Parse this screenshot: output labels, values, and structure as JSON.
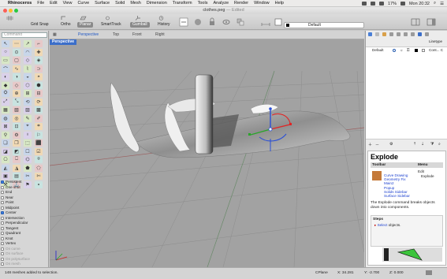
{
  "menubar": {
    "app_name": "Rhinoceros",
    "items": [
      "File",
      "Edit",
      "View",
      "Curve",
      "Surface",
      "Solid",
      "Mesh",
      "Dimension",
      "Transform",
      "Tools",
      "Analyze",
      "Render",
      "Window",
      "Help"
    ],
    "battery": "17%",
    "clock": "Mon 20:32"
  },
  "window": {
    "title": "clothes.peg",
    "edited_label": "— Edited"
  },
  "toolbar": {
    "buttons": [
      "Grid Snap",
      "Ortho",
      "Planar",
      "SmartTrack",
      "Gumball",
      "History"
    ],
    "active_buttons": [
      "Planar",
      "Gumball"
    ],
    "layer_value": "Default"
  },
  "command": {
    "placeholder": "Command"
  },
  "tools": [
    "↖",
    "⋯",
    "↗",
    "⌐",
    "○",
    "⊙",
    "◠",
    "✚",
    "▭",
    "▢",
    "◇",
    "◈",
    "⌒",
    "∿",
    "⌇",
    "⊃",
    "◐",
    "◑",
    "◒",
    "◓",
    "◆",
    "◇",
    "⬡",
    "⬢",
    "⛭",
    "⊕",
    "⊞",
    "⊟",
    "⤢",
    "⤡",
    "⟲",
    "⟳",
    "▦",
    "▧",
    "▨",
    "▩",
    "◍",
    "◎",
    "✎",
    "✐",
    "⊠",
    "⊡",
    "⌖",
    "⌗",
    "⚲",
    "⚙",
    "♁",
    "⚐",
    "❏",
    "❐",
    "⬚",
    "⬛",
    "◪",
    "◩",
    "☐",
    "☑",
    "⎔",
    "⎕",
    "⌬",
    "⍟",
    "◭",
    "◮",
    "⬟",
    "⬠",
    "▣",
    "▤",
    "✂",
    "✄",
    "⚒",
    "⚓",
    "⚑",
    "⚬"
  ],
  "osnap": [
    {
      "label": "Persistent",
      "on": true,
      "dim": false
    },
    {
      "label": "One shot",
      "on": false,
      "dim": false
    },
    {
      "label": "End",
      "on": false,
      "dim": false
    },
    {
      "label": "Near",
      "on": false,
      "dim": false
    },
    {
      "label": "Point",
      "on": false,
      "dim": false
    },
    {
      "label": "Midpoint",
      "on": false,
      "dim": false
    },
    {
      "label": "Center",
      "on": true,
      "dim": false
    },
    {
      "label": "Intersection",
      "on": false,
      "dim": false
    },
    {
      "label": "Perpendicular",
      "on": false,
      "dim": false
    },
    {
      "label": "Tangent",
      "on": false,
      "dim": false
    },
    {
      "label": "Quadrant",
      "on": false,
      "dim": false
    },
    {
      "label": "Knot",
      "on": false,
      "dim": false
    },
    {
      "label": "Vertex",
      "on": false,
      "dim": false
    },
    {
      "label": "On curve",
      "on": false,
      "dim": true
    },
    {
      "label": "On surface",
      "on": false,
      "dim": true
    },
    {
      "label": "On polysurface",
      "on": false,
      "dim": true
    },
    {
      "label": "On mesh",
      "on": false,
      "dim": true
    },
    {
      "label": "Project",
      "on": false,
      "dim": false
    },
    {
      "label": "SmartTrack",
      "on": false,
      "dim": false
    }
  ],
  "view_tabs": [
    "Perspective",
    "Top",
    "Front",
    "Right"
  ],
  "viewport": {
    "label": "Perspective"
  },
  "layers": {
    "col_linetype": "Linetype",
    "row_name": "Default",
    "row_linetype": "Cont... C"
  },
  "help": {
    "title": "Explode",
    "toolbar_head": "Toolbar",
    "menu_head": "Menu",
    "toolbar_links": [
      "Curve Drawing",
      "Geometry Fix",
      "Main2",
      "Popup",
      "Solids Sidebar",
      "Surface Sidebar"
    ],
    "menu_values": [
      "Edit",
      "Explode"
    ],
    "description": "The Explode command breaks objects down into components.",
    "steps_head": "Steps",
    "step1_link": "Select",
    "step1_rest": "objects."
  },
  "status": {
    "message": "148 meshes added to selection.",
    "cplane": "CPlane",
    "x": "X: 34.281",
    "y": "Y: -2.700",
    "z": "Z: 0.000"
  },
  "colors": {
    "accent": "#3b6ec9",
    "link": "#1a3fcf",
    "viewport_bg": "#a2a2a2"
  }
}
